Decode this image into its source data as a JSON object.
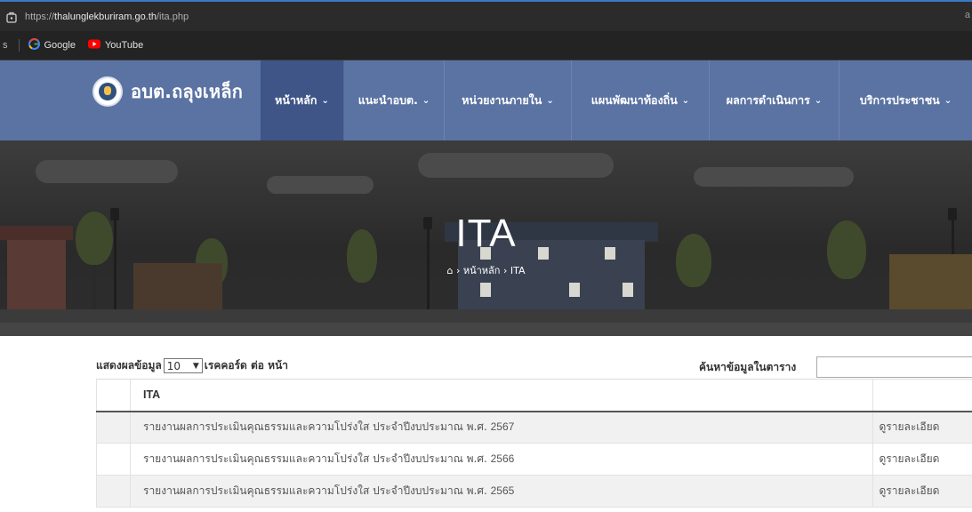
{
  "browser": {
    "url_scheme": "https://",
    "url_host": "thalunglekburiram.go.th",
    "url_path": "/ita.php",
    "right_fragment": "a",
    "bookmark_fragment": "s",
    "bookmarks": [
      {
        "label": "Google",
        "icon": "google-icon"
      },
      {
        "label": "YouTube",
        "icon": "youtube-icon"
      }
    ]
  },
  "site": {
    "logo_text": "อบต.ถลุงเหล็ก",
    "menu": [
      {
        "label": "หน้าหลัก",
        "active": true
      },
      {
        "label": "แนะนำอบต.",
        "active": false
      },
      {
        "label": "หน่วยงานภายใน",
        "active": false
      },
      {
        "label": "แผนพัฒนาท้องถิ่น",
        "active": false
      },
      {
        "label": "ผลการดำเนินการ",
        "active": false
      },
      {
        "label": "บริการประชาชน",
        "active": false
      }
    ],
    "chevron": "⌄"
  },
  "hero": {
    "title": "ITA",
    "crumb_home_icon": "home-icon",
    "crumb_sep": "›",
    "crumb_items": [
      "หน้าหลัก",
      "ITA"
    ]
  },
  "table_controls": {
    "show_prefix": "แสดงผลข้อมูล",
    "page_size": "10",
    "show_suffix": "เรคคอร์ด ต่อ หน้า",
    "search_label": "ค้นหาข้อมูลในตาราง",
    "search_value": ""
  },
  "table": {
    "header": "ITA",
    "rows": [
      {
        "title": "รายงานผลการประเมินคุณธรรมและความโปร่งใส ประจำปีงบประมาณ พ.ศ. ",
        "year": "2567",
        "action": "ดูรายละเอียด"
      },
      {
        "title": "รายงานผลการประเมินคุณธรรมและความโปร่งใส ประจำปีงบประมาณ พ.ศ. ",
        "year": "2566",
        "action": "ดูรายละเอียด"
      },
      {
        "title": "รายงานผลการประเมินคุณธรรมและความโปร่งใส ประจำปีงบประมาณ พ.ศ. ",
        "year": "2565",
        "action": "ดูรายละเอียด"
      }
    ]
  },
  "colors": {
    "nav_bg": "#5b73a3",
    "nav_active": "#3f5588",
    "browser_bg": "#2b2b2b"
  }
}
